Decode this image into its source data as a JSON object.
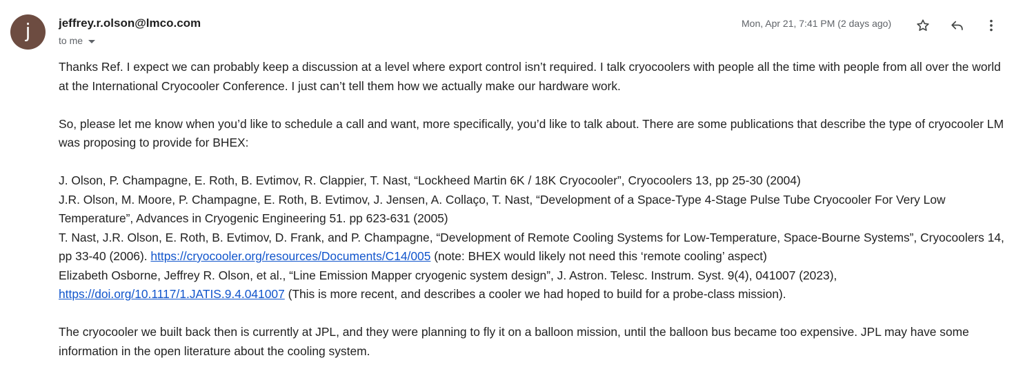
{
  "sender": {
    "avatar_letter": "j",
    "avatar_color": "#6d4c41",
    "email": "jeffrey.r.olson@lmco.com",
    "recipient_label": "to me"
  },
  "meta": {
    "date": "Mon, Apr 21, 7:41 PM (2 days ago)"
  },
  "icons": {
    "star": "star-icon",
    "reply": "reply-icon",
    "more": "more-vert-icon"
  },
  "body": {
    "p1": "Thanks Ref.  I expect we can probably keep a discussion at a level where export control isn’t required.  I talk cryocoolers with people all the time with people from all over the world at the International Cryocooler Conference.  I just can’t tell them how we actually make our hardware work.",
    "p2": "So, please let me know when you’d like to schedule a call and want, more specifically, you’d like to talk about.  There are some publications that describe the type of cryocooler LM was proposing to provide for BHEX:",
    "ref1": "J. Olson, P. Champagne, E. Roth, B. Evtimov, R. Clappier, T. Nast, “Lockheed Martin 6K / 18K Cryocooler”, Cryocoolers 13, pp 25-30 (2004)",
    "ref2": "J.R. Olson, M. Moore, P. Champagne, E. Roth, B. Evtimov, J. Jensen, A. Collaço, T. Nast, “Development of a Space-Type 4-Stage Pulse Tube Cryocooler For Very Low Temperature”, Advances in Cryogenic Engineering 51. pp 623-631 (2005)",
    "ref3_text": "T. Nast, J.R. Olson, E. Roth, B. Evtimov, D. Frank, and P. Champagne, “Development of Remote Cooling Systems for Low-Temperature, Space-Bourne Systems”, Cryocoolers 14, pp 33-40 (2006).  ",
    "ref3_link": "https://cryocooler.org/resources/Documents/C14/005",
    "ref3_after": " (note:  BHEX would likely not need this ‘remote cooling’ aspect)",
    "ref4_text": "Elizabeth Osborne, Jeffrey R. Olson, et al., “Line Emission Mapper cryogenic system design”, J. Astron. Telesc. Instrum. Syst. 9(4), 041007 (2023), ",
    "ref4_link": "https://doi.org/10.1117/1.JATIS.9.4.041007",
    "ref4_after": " (This is more recent, and describes a cooler we had hoped to build for a probe-class mission).",
    "p3": "The cryocooler we built back then is currently at JPL, and they were planning to fly it on a balloon mission, until the balloon bus became too expensive.  JPL may have some information in the open literature about the cooling system."
  },
  "colors": {
    "link": "#1155cc",
    "text": "#222222",
    "muted": "#5f6368"
  }
}
